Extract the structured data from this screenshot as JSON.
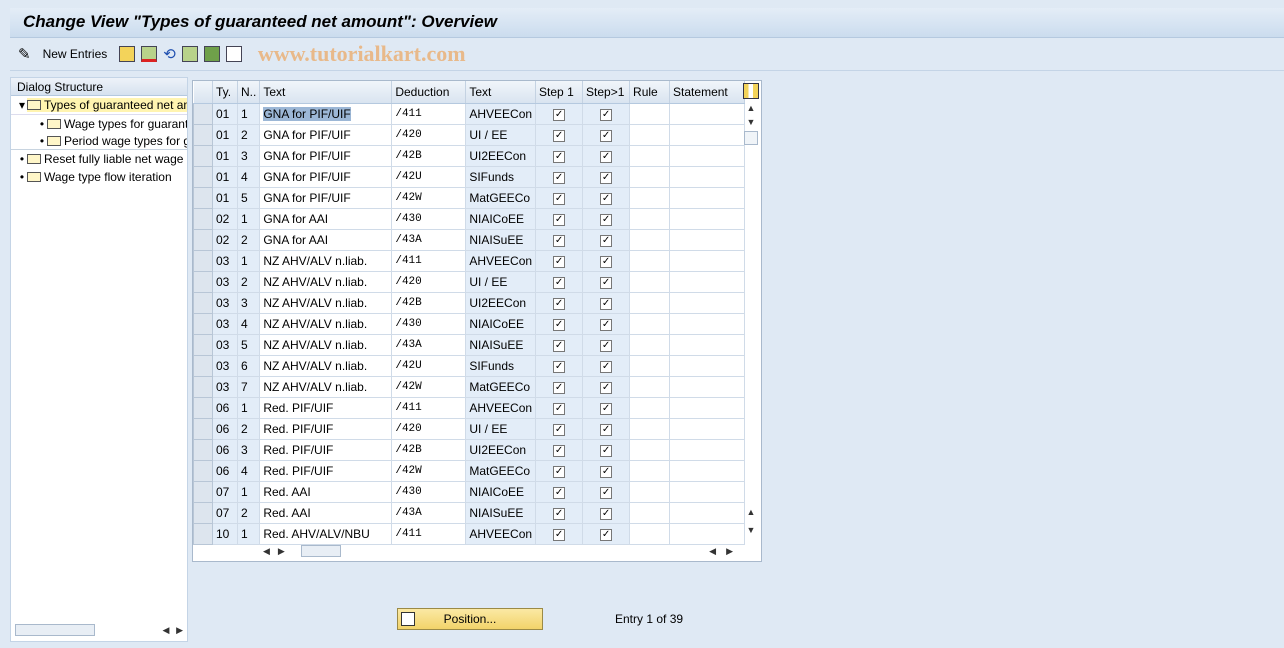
{
  "title": "Change View \"Types of guaranteed net amount\": Overview",
  "toolbar": {
    "new_entries": "New Entries",
    "watermark": "www.tutorialkart.com"
  },
  "dialog": {
    "header": "Dialog Structure",
    "items": [
      {
        "label": "Types of guaranteed net amount",
        "level": 0,
        "selected": true,
        "expanded": true
      },
      {
        "label": "Wage types for guaranteed net amount",
        "level": 1
      },
      {
        "label": "Period wage types for guaranteed net amount",
        "level": 1
      },
      {
        "label": "Reset fully liable net wage",
        "level": 0
      },
      {
        "label": "Wage type flow iteration",
        "level": 0
      }
    ]
  },
  "table": {
    "columns": [
      "Ty.",
      "N..",
      "Text",
      "Deduction",
      "Text",
      "Step 1",
      "Step>1",
      "Rule",
      "Statement"
    ],
    "rows": [
      [
        "01",
        "1",
        "GNA for PIF/UIF",
        "/411",
        "AHVEECon",
        true,
        true,
        "",
        ""
      ],
      [
        "01",
        "2",
        "GNA for PIF/UIF",
        "/420",
        "UI / EE",
        true,
        true,
        "",
        ""
      ],
      [
        "01",
        "3",
        "GNA for PIF/UIF",
        "/42B",
        "UI2EECon",
        true,
        true,
        "",
        ""
      ],
      [
        "01",
        "4",
        "GNA for PIF/UIF",
        "/42U",
        "SIFunds",
        true,
        true,
        "",
        ""
      ],
      [
        "01",
        "5",
        "GNA for PIF/UIF",
        "/42W",
        "MatGEECo",
        true,
        true,
        "",
        ""
      ],
      [
        "02",
        "1",
        "GNA for AAI",
        "/430",
        "NIAICoEE",
        true,
        true,
        "",
        ""
      ],
      [
        "02",
        "2",
        "GNA for AAI",
        "/43A",
        "NIAISuEE",
        true,
        true,
        "",
        ""
      ],
      [
        "03",
        "1",
        "NZ AHV/ALV n.liab.",
        "/411",
        "AHVEECon",
        true,
        true,
        "",
        ""
      ],
      [
        "03",
        "2",
        "NZ AHV/ALV n.liab.",
        "/420",
        "UI / EE",
        true,
        true,
        "",
        ""
      ],
      [
        "03",
        "3",
        "NZ AHV/ALV n.liab.",
        "/42B",
        "UI2EECon",
        true,
        true,
        "",
        ""
      ],
      [
        "03",
        "4",
        "NZ AHV/ALV n.liab.",
        "/430",
        "NIAICoEE",
        true,
        true,
        "",
        ""
      ],
      [
        "03",
        "5",
        "NZ AHV/ALV n.liab.",
        "/43A",
        "NIAISuEE",
        true,
        true,
        "",
        ""
      ],
      [
        "03",
        "6",
        "NZ AHV/ALV n.liab.",
        "/42U",
        "SIFunds",
        true,
        true,
        "",
        ""
      ],
      [
        "03",
        "7",
        "NZ AHV/ALV n.liab.",
        "/42W",
        "MatGEECo",
        true,
        true,
        "",
        ""
      ],
      [
        "06",
        "1",
        "Red. PIF/UIF",
        "/411",
        "AHVEECon",
        true,
        true,
        "",
        ""
      ],
      [
        "06",
        "2",
        "Red. PIF/UIF",
        "/420",
        "UI / EE",
        true,
        true,
        "",
        ""
      ],
      [
        "06",
        "3",
        "Red. PIF/UIF",
        "/42B",
        "UI2EECon",
        true,
        true,
        "",
        ""
      ],
      [
        "06",
        "4",
        "Red. PIF/UIF",
        "/42W",
        "MatGEECo",
        true,
        true,
        "",
        ""
      ],
      [
        "07",
        "1",
        "Red. AAI",
        "/430",
        "NIAICoEE",
        true,
        true,
        "",
        ""
      ],
      [
        "07",
        "2",
        "Red. AAI",
        "/43A",
        "NIAISuEE",
        true,
        true,
        "",
        ""
      ],
      [
        "10",
        "1",
        "Red. AHV/ALV/NBU",
        "/411",
        "AHVEECon",
        true,
        true,
        "",
        ""
      ]
    ]
  },
  "footer": {
    "position_button": "Position...",
    "entry_info": "Entry 1 of 39"
  }
}
